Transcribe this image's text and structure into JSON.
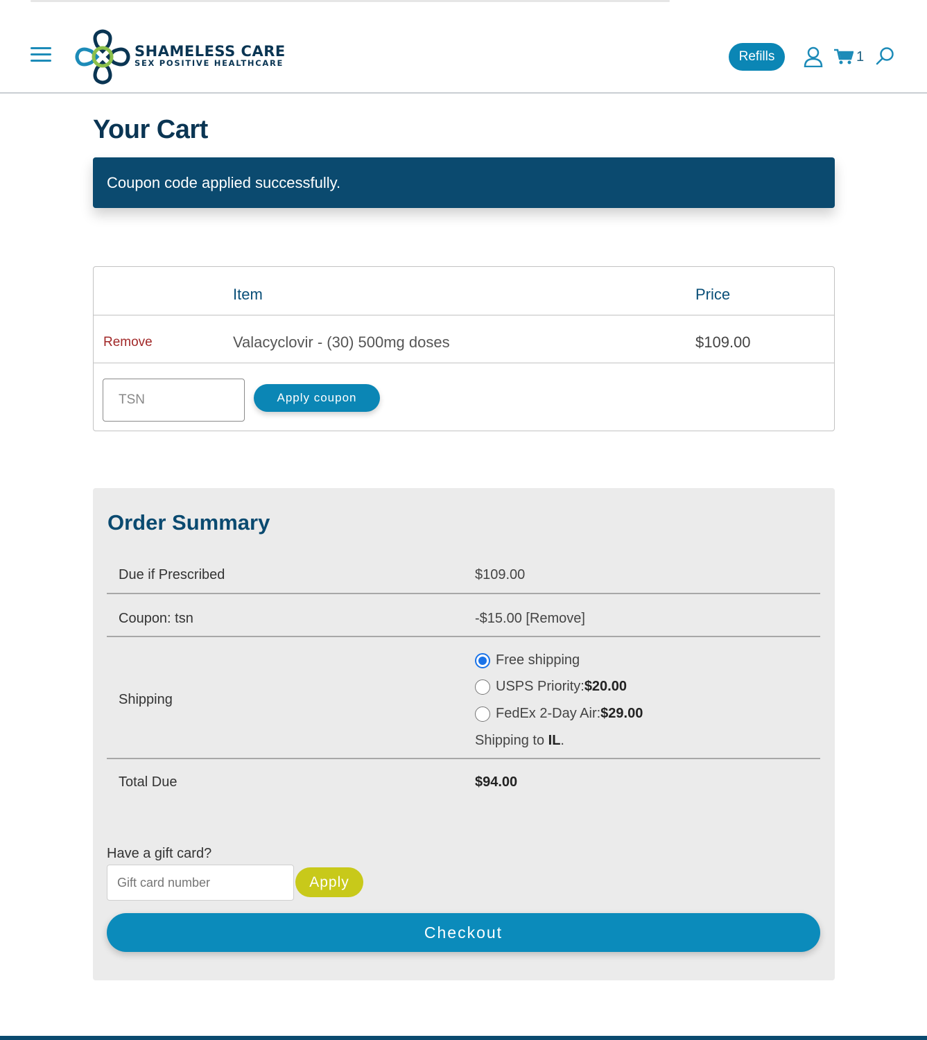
{
  "header": {
    "logo_title": "SHAMELESS CARE",
    "logo_subtitle": "SEX POSITIVE HEALTHCARE",
    "refills_label": "Refills",
    "cart_count": "1"
  },
  "cart": {
    "title": "Your Cart",
    "notice": "Coupon code applied successfully.",
    "columns": {
      "item": "Item",
      "price": "Price"
    },
    "items": [
      {
        "remove_label": "Remove",
        "name": "Valacyclovir - (30) 500mg doses",
        "price": "$109.00"
      }
    ],
    "coupon": {
      "value": "TSN",
      "apply_label": "Apply coupon"
    }
  },
  "summary": {
    "title": "Order Summary",
    "due_label": "Due if Prescribed",
    "due_value": "$109.00",
    "coupon_label": "Coupon: tsn",
    "coupon_value": "-$15.00 [Remove]",
    "shipping_label": "Shipping",
    "shipping_options": [
      {
        "label": "Free shipping",
        "price": "",
        "selected": true
      },
      {
        "label": "USPS Priority: ",
        "price": "$20.00",
        "selected": false
      },
      {
        "label": "FedEx 2-Day Air: ",
        "price": "$29.00",
        "selected": false
      }
    ],
    "shipping_to_prefix": "Shipping to ",
    "shipping_to_state": "IL",
    "shipping_to_suffix": ".",
    "total_label": "Total Due",
    "total_value": "$94.00",
    "gift_label": "Have a gift card?",
    "gift_placeholder": "Gift card number",
    "gift_apply_label": "Apply",
    "checkout_label": "Checkout"
  },
  "colors": {
    "brand_dark": "#0a3553",
    "brand_blue": "#0b86b5",
    "notice_bg": "#0b4a6f",
    "gift_apply": "#c8c91a",
    "remove_red": "#a12828"
  },
  "icons": [
    "menu-icon",
    "logo-cross-icon",
    "user-icon",
    "cart-icon",
    "search-icon"
  ]
}
